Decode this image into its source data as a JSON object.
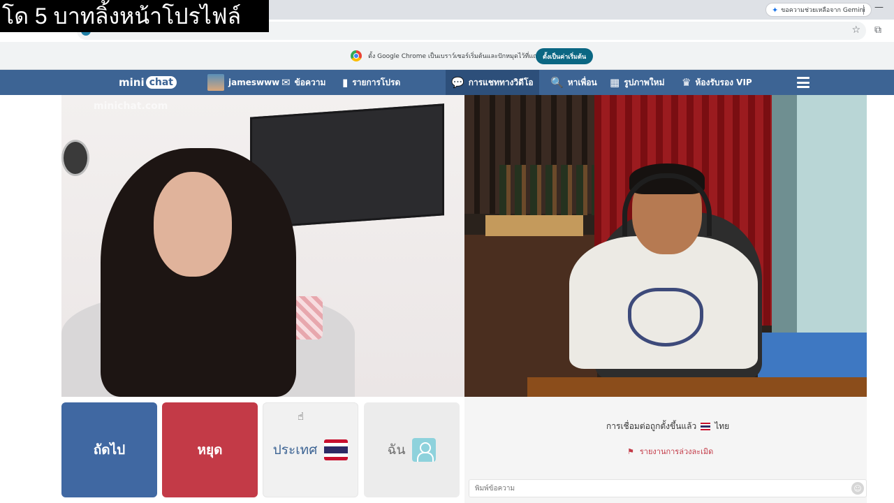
{
  "overlay": {
    "caption": "โด 5 บาทลิ้งหน้าโปรไฟล์"
  },
  "browser": {
    "gemini_pill": "ขอความช่วยเหลือจาก Gemini",
    "infobar_text": "ตั้ง Google Chrome เป็นเบราว์เซอร์เริ่มต้นและปักหมุดไว้ที่แถบงาน",
    "default_button": "ตั้งเป็นค่าเริ่มต้น",
    "icons": [
      "star-icon",
      "extensions-icon",
      "chrome-logo"
    ]
  },
  "site": {
    "logo": {
      "mini": "mini",
      "chat": "chat"
    },
    "nav": {
      "username": "jameswww",
      "messages": "ข้อความ",
      "favorites": "รายการโปรด",
      "video_chat": "การแชททางวิดีโอ",
      "find_friends": "หาเพื่อน",
      "new_photos": "รูปภาพใหม่",
      "vip_room": "ห้องรับรอง VIP"
    },
    "watermark": "minichat.com",
    "accent_color": "#3d6494"
  },
  "controls": {
    "next": "ถัดไป",
    "stop": "หยุด",
    "country": "ประเทศ",
    "me": "ฉัน",
    "colors": {
      "next": "#4068a2",
      "stop": "#c33a47"
    }
  },
  "chat": {
    "connection_text": "การเชื่อมต่อถูกตั้งขึ้นแล้ว",
    "country_name": "ไทย",
    "report_text": "รายงานการล่วงละเมิด",
    "input_placeholder": "พิมพ์ข้อความ"
  }
}
